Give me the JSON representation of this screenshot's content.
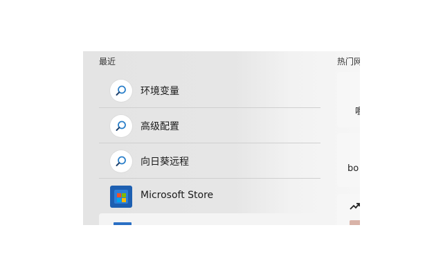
{
  "recent": {
    "title": "最近",
    "items": [
      {
        "label": "环境变量",
        "icon": "search-icon"
      },
      {
        "label": "高级配置",
        "icon": "search-icon"
      },
      {
        "label": "向日葵远程",
        "icon": "search-icon"
      },
      {
        "label": "Microsoft Store",
        "icon": "microsoft-store-icon"
      }
    ]
  },
  "trending": {
    "title": "热门网",
    "cards": [
      {
        "text": "喔"
      },
      {
        "text": "bo"
      },
      {
        "icon": "trending-up-icon"
      }
    ]
  },
  "colors": {
    "accent": "#2a7fc9",
    "store_blue": "#1d5fb1"
  }
}
